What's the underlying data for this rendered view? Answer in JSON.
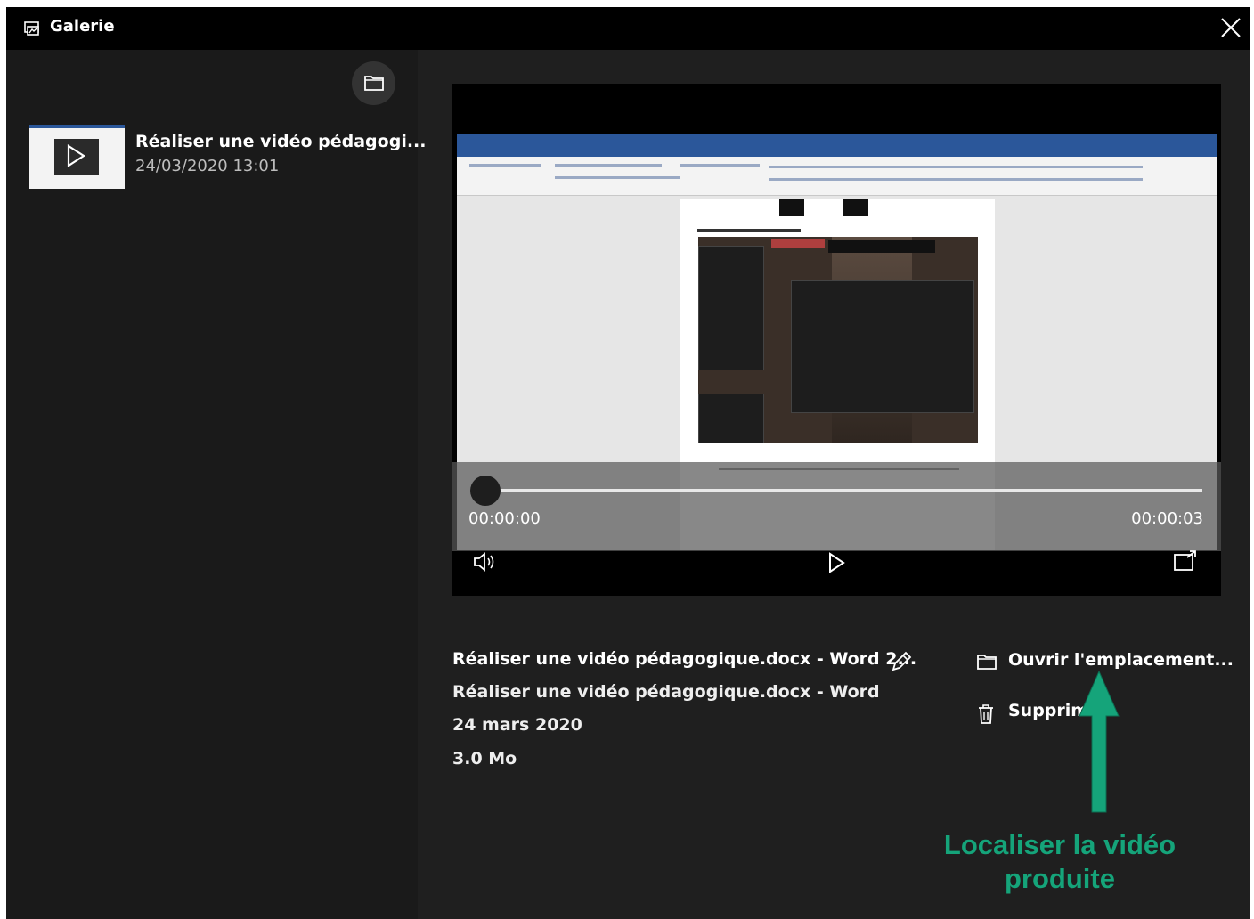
{
  "window": {
    "title": "Galerie",
    "icon": "gallery-icon",
    "close_icon": "close-icon"
  },
  "sidebar": {
    "open_folder_icon": "folder-icon",
    "items": [
      {
        "title": "Réaliser une vidéo pédagogi...",
        "date": "24/03/2020 13:01",
        "thumbnail_icon": "play-icon"
      }
    ]
  },
  "player": {
    "current_time": "00:00:00",
    "duration": "00:00:03",
    "progress": 0,
    "volume_icon": "volume-icon",
    "play_icon": "play-icon",
    "cast_icon": "cast-icon"
  },
  "details": {
    "title": "Réaliser une vidéo pédagogique.docx - Word 2...",
    "app": "Réaliser une vidéo pédagogique.docx - Word",
    "date": "24 mars 2020",
    "size": "3.0 Mo",
    "edit_icon": "pencil-icon"
  },
  "actions": {
    "open_location": "Ouvrir l'emplacement...",
    "delete": "Supprim"
  },
  "annotation": {
    "line1": "Localiser la vidéo",
    "line2": "produite",
    "color": "#15a47a"
  },
  "colors": {
    "titlebar": "#000000",
    "sidebar": "#1a1a1a",
    "main": "#1f1f1f",
    "word_blue": "#2b579a"
  }
}
